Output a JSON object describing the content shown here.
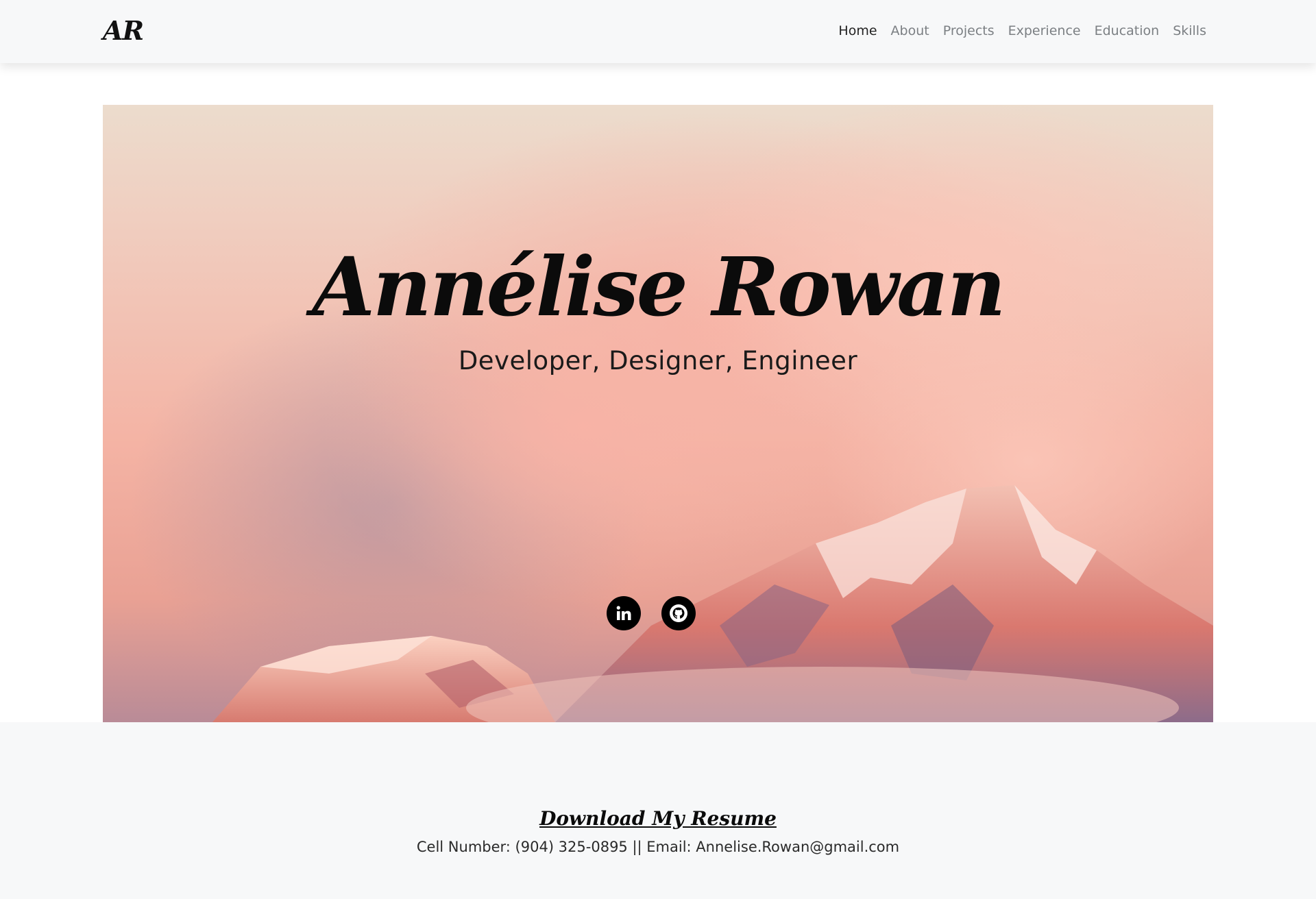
{
  "nav": {
    "brand": "AR",
    "links": [
      {
        "label": "Home",
        "active": true
      },
      {
        "label": "About"
      },
      {
        "label": "Projects"
      },
      {
        "label": "Experience"
      },
      {
        "label": "Education"
      },
      {
        "label": "Skills"
      }
    ]
  },
  "hero": {
    "name": "Annélise Rowan",
    "tagline": "Developer, Designer, Engineer",
    "social": [
      {
        "icon": "linkedin-icon"
      },
      {
        "icon": "github-icon"
      }
    ]
  },
  "footer": {
    "resume_label": "Download My Resume",
    "contact_line": "Cell Number: (904) 325-0895 || Email: Annelise.Rowan@gmail.com"
  },
  "colors": {
    "navbar_bg": "#f7f8f9",
    "text_dark": "#0b0b0b",
    "nav_muted": "#7b7f83"
  }
}
